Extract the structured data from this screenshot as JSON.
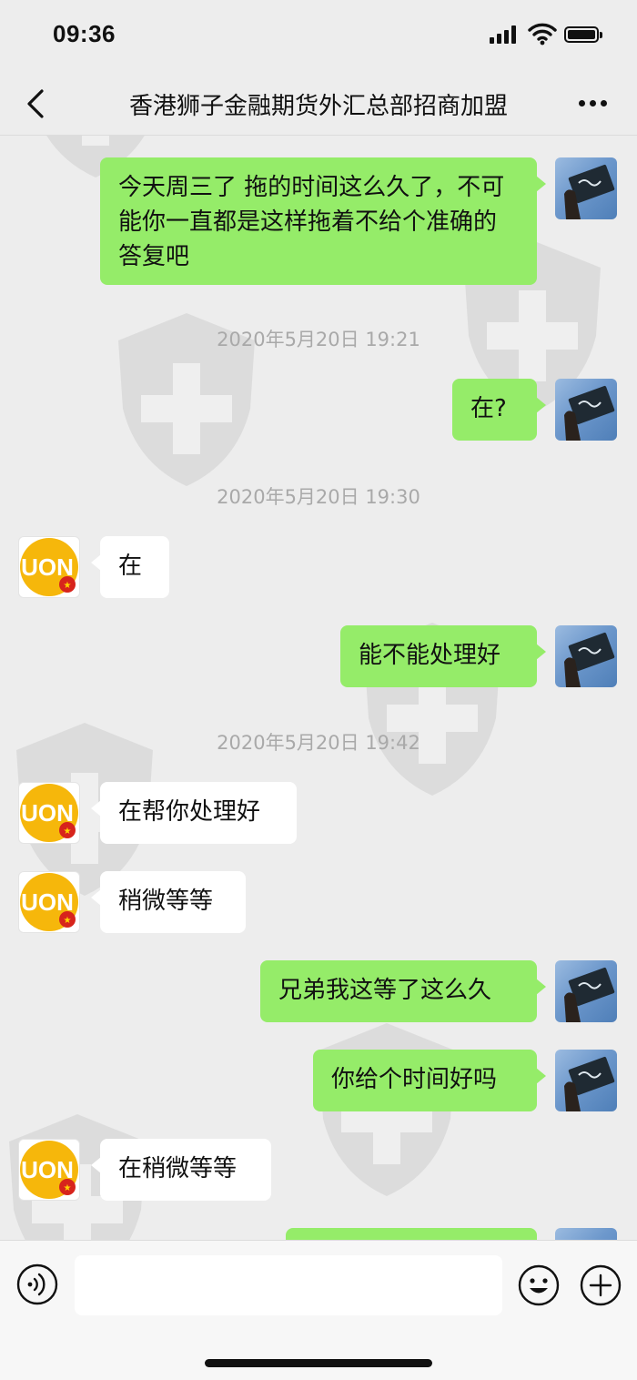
{
  "status_bar": {
    "time": "09:36"
  },
  "header": {
    "title": "香港狮子金融期货外汇总部招商加盟"
  },
  "avatars": {
    "other_text": "UON"
  },
  "messages": {
    "m1": {
      "text": "今天周三了   拖的时间这么久了，不可能你一直都是这样拖着不给个准确的答复吧"
    },
    "t1": {
      "text": "2020年5月20日 19:21"
    },
    "m2": {
      "text": "在?"
    },
    "t2": {
      "text": "2020年5月20日 19:30"
    },
    "m3": {
      "text": "在"
    },
    "m4": {
      "text": "能不能处理好"
    },
    "t3": {
      "text": "2020年5月20日 19:42"
    },
    "m5": {
      "text": "在帮你处理好"
    },
    "m6": {
      "text": "稍微等等"
    },
    "m7": {
      "text": "兄弟我这等了这么久"
    },
    "m8": {
      "text": "你给个时间好吗"
    },
    "m9": {
      "text": "在稍微等等"
    }
  },
  "input": {
    "value": ""
  },
  "colors": {
    "my_bubble": "#95ec69",
    "their_bubble": "#ffffff",
    "background": "#ededed",
    "avatar_brand": "#f6b70b"
  },
  "icons": [
    "back-icon",
    "more-icon",
    "voice-icon",
    "emoji-icon",
    "plus-icon"
  ]
}
